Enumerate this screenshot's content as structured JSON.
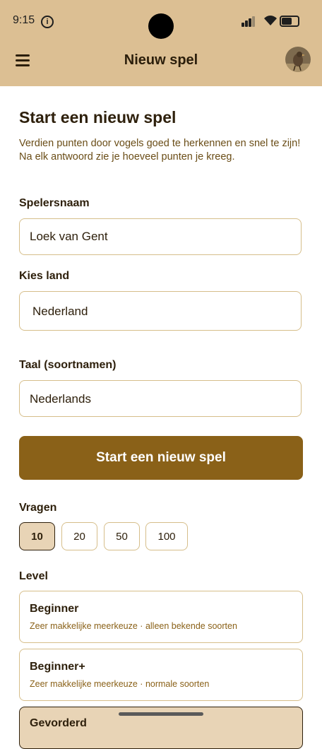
{
  "status_bar": {
    "time": "9:15",
    "info_glyph": "i"
  },
  "app_bar": {
    "title": "Nieuw spel",
    "menu_icon": "hamburger-icon",
    "avatar_icon": "bird-avatar"
  },
  "page": {
    "title": "Start een nieuw spel",
    "intro": "Verdien punten door vogels goed te herkennen en snel te zijn! Na elk antwoord zie je hoeveel punten je kreeg."
  },
  "form": {
    "player_label": "Spelersnaam",
    "player_value": "Loek van Gent",
    "country_label": "Kies land",
    "country_value": "Nederland",
    "language_label": "Taal (soortnamen)",
    "language_value": "Nederlands",
    "start_button": "Start een nieuw spel"
  },
  "questions": {
    "label": "Vragen",
    "options": [
      "10",
      "20",
      "50",
      "100"
    ],
    "selected": "10"
  },
  "level": {
    "label": "Level",
    "options": [
      {
        "title": "Beginner",
        "desc": "Zeer makkelijke meerkeuze · alleen bekende soorten"
      },
      {
        "title": "Beginner+",
        "desc": "Zeer makkelijke meerkeuze · normale soorten"
      },
      {
        "title": "Gevorderd",
        "desc": ""
      }
    ]
  },
  "colors": {
    "accent": "#8a6118",
    "header": "#dcbf93",
    "selected": "#e8d4b6"
  }
}
